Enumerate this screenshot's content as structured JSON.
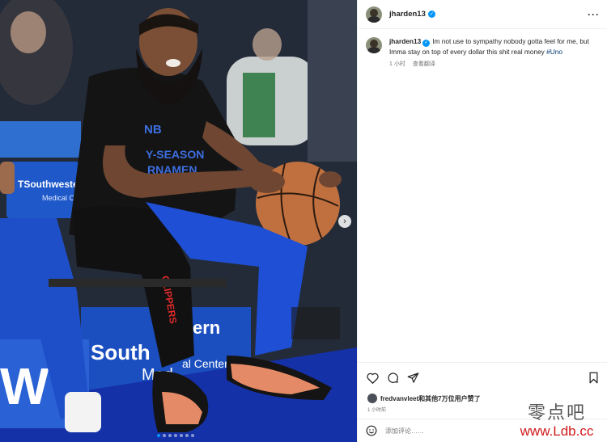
{
  "post": {
    "username": "jharden13",
    "caption_user": "jharden13",
    "caption_text": "Im not use to sympathy nobody gotta feel for me, but Imma stay on top of every dollar this shit real money ",
    "hashtag": "#Uno",
    "time": "1 小时",
    "translate": "查看翻译"
  },
  "photo": {
    "shirt_text_1": "NB",
    "shirt_text_2": "Y-SEASON",
    "shirt_text_3": "RNAMEN",
    "banner_1": "TSouthweste",
    "banner_1b": "Medical Ce",
    "banner_2": "South",
    "banner_2b": "ern",
    "banner_3": "Med",
    "banner_3b": "al Center",
    "pants_text": "CLIPPERS",
    "court_text": "W"
  },
  "engagement": {
    "likes_text": "fredvanvleet和其他7万位用户赞了",
    "time_short": "1 小时前"
  },
  "comment": {
    "placeholder": "添加评论……"
  },
  "watermark": {
    "cn": "零点吧",
    "url": "www.Ldb.cc"
  },
  "carousel": {
    "count": 7,
    "active": 0
  },
  "colors": {
    "accent": "#0095f6",
    "hashtag": "#00376b",
    "watermark_red": "#d0191b"
  },
  "icons": [
    "verified-icon",
    "more-icon",
    "heart-icon",
    "comment-icon",
    "share-icon",
    "bookmark-icon",
    "emoji-icon",
    "chevron-right-icon"
  ]
}
